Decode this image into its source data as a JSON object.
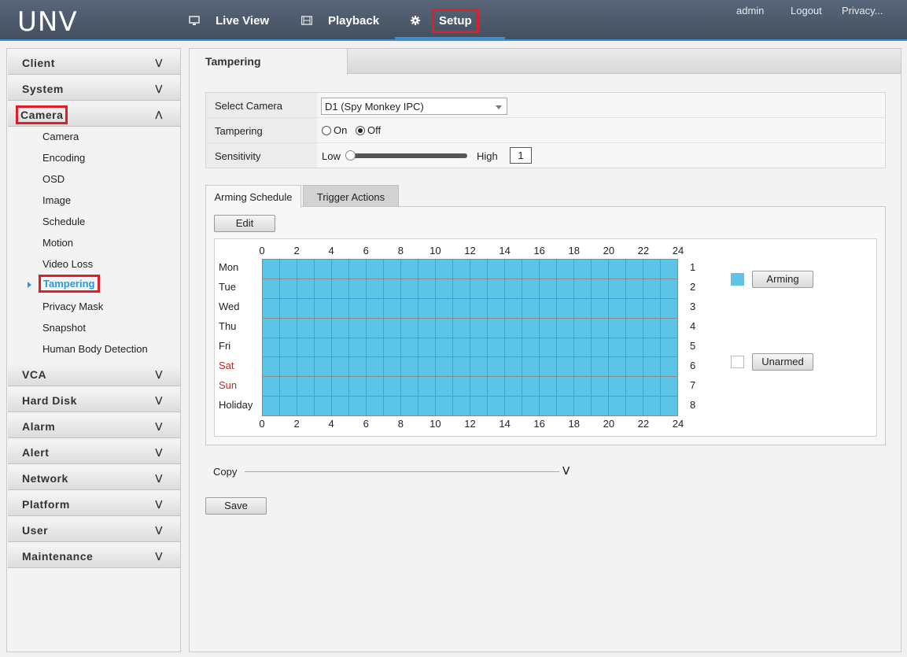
{
  "header": {
    "logo": "UNV",
    "nav": [
      {
        "label": "Live View",
        "icon": "monitor-icon"
      },
      {
        "label": "Playback",
        "icon": "film-icon"
      },
      {
        "label": "Setup",
        "icon": "gear-icon"
      }
    ],
    "links": [
      "admin",
      "Logout",
      "Privacy..."
    ]
  },
  "sidebar": {
    "sections": [
      "Client",
      "System",
      "Camera",
      "VCA",
      "Hard Disk",
      "Alarm",
      "Alert",
      "Network",
      "Platform",
      "User",
      "Maintenance"
    ],
    "camera_items": [
      "Camera",
      "Encoding",
      "OSD",
      "Image",
      "Schedule",
      "Motion",
      "Video Loss",
      "Tampering",
      "Privacy Mask",
      "Snapshot",
      "Human Body Detection"
    ],
    "active_item": "Tampering"
  },
  "page": {
    "tab_title": "Tampering",
    "form": {
      "camera_label": "Select Camera",
      "camera_value": "D1 (Spy Monkey IPC)",
      "tampering_label": "Tampering",
      "on_label": "On",
      "off_label": "Off",
      "tampering_state": "Off",
      "sensitivity_label": "Sensitivity",
      "low_label": "Low",
      "high_label": "High",
      "sensitivity_value": "1"
    },
    "schedule_tabs": [
      "Arming Schedule",
      "Trigger Actions"
    ],
    "edit_button": "Edit",
    "hours": [
      "0",
      "2",
      "4",
      "6",
      "8",
      "10",
      "12",
      "14",
      "16",
      "18",
      "20",
      "22",
      "24"
    ],
    "days": [
      "Mon",
      "Tue",
      "Wed",
      "Thu",
      "Fri",
      "Sat",
      "Sun",
      "Holiday"
    ],
    "row_numbers": [
      "1",
      "2",
      "3",
      "4",
      "5",
      "6",
      "7",
      "8"
    ],
    "arming_label": "Arming",
    "unarmed_label": "Unarmed",
    "copy_label": "Copy",
    "save_button": "Save"
  },
  "colors": {
    "armed": "#5bc4e7",
    "highlight_border": "#e01e25",
    "active_link": "#2a9ad6",
    "weekend": "#c8281e"
  }
}
